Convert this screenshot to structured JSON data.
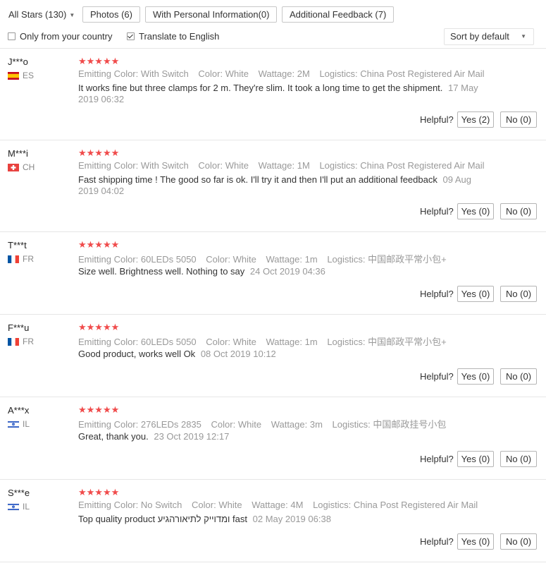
{
  "filters": {
    "all_stars": "All Stars (130)",
    "photos": "Photos (6)",
    "personal_info": "With Personal Information(0)",
    "additional_feedback": "Additional Feedback (7)",
    "only_country": "Only from your country",
    "translate": "Translate to English",
    "sort": "Sort by default"
  },
  "colors": {
    "star": "#f04b4b",
    "meta": "#999999",
    "border": "#e6e6e6"
  },
  "labels": {
    "emitting_color": "Emitting Color:",
    "color": "Color:",
    "wattage": "Wattage:",
    "logistics": "Logistics:",
    "helpful": "Helpful?"
  },
  "reviews": [
    {
      "user": "J***o",
      "country": "ES",
      "flag": "es-flag-icon",
      "stars": "★★★★★",
      "emitting_color": "With Switch",
      "color": "White",
      "wattage": "2M",
      "logistics": "China Post Registered Air Mail",
      "text": "It works fine but three clamps for 2 m. They're slim. It took a long time to get the shipment.",
      "date": "17 May 2019 06:32",
      "yes": "Yes (2)",
      "no": "No (0)"
    },
    {
      "user": "M***i",
      "country": "CH",
      "flag": "ch-flag-icon",
      "stars": "★★★★★",
      "emitting_color": "With Switch",
      "color": "White",
      "wattage": "1M",
      "logistics": "China Post Registered Air Mail",
      "text": "Fast shipping time ! The good so far is ok. I'll try it and then I'll put an additional feedback",
      "date": "09 Aug 2019 04:02",
      "yes": "Yes (0)",
      "no": "No (0)"
    },
    {
      "user": "T***t",
      "country": "FR",
      "flag": "fr-flag-icon",
      "stars": "★★★★★",
      "emitting_color": "60LEDs 5050",
      "color": "White",
      "wattage": "1m",
      "logistics": "中国邮政平常小包+",
      "text": "Size well. Brightness well. Nothing to say",
      "date": "24 Oct 2019 04:36",
      "yes": "Yes (0)",
      "no": "No (0)"
    },
    {
      "user": "F***u",
      "country": "FR",
      "flag": "fr-flag-icon",
      "stars": "★★★★★",
      "emitting_color": "60LEDs 5050",
      "color": "White",
      "wattage": "1m",
      "logistics": "中国邮政平常小包+",
      "text": "Good product, works well Ok",
      "date": "08 Oct 2019 10:12",
      "yes": "Yes (0)",
      "no": "No (0)"
    },
    {
      "user": "A***x",
      "country": "IL",
      "flag": "il-flag-icon",
      "stars": "★★★★★",
      "emitting_color": "276LEDs 2835",
      "color": "White",
      "wattage": "3m",
      "logistics": "中国邮政挂号小包",
      "text": "Great, thank you.",
      "date": "23 Oct 2019 12:17",
      "yes": "Yes (0)",
      "no": "No (0)"
    },
    {
      "user": "S***e",
      "country": "IL",
      "flag": "il-flag-icon",
      "stars": "★★★★★",
      "emitting_color": "No Switch",
      "color": "White",
      "wattage": "4M",
      "logistics": "China Post Registered Air Mail",
      "text": "Top quality product ומדוייק לתיאורהגיע fast",
      "date": "02 May 2019 06:38",
      "yes": "Yes (0)",
      "no": "No (0)"
    }
  ]
}
